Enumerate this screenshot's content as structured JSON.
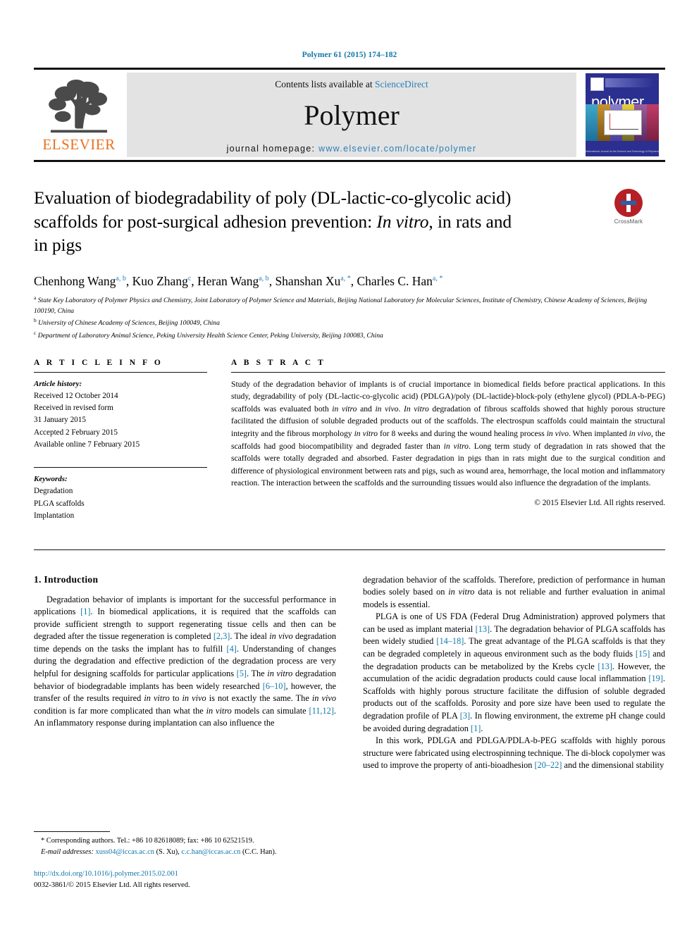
{
  "running_head": "Polymer 61 (2015) 174–182",
  "masthead": {
    "publisher_name": "ELSEVIER",
    "contents_prefix": "Contents lists available at ",
    "contents_link": "ScienceDirect",
    "journal_name": "Polymer",
    "homepage_prefix": "journal homepage: ",
    "homepage_url": "www.elsevier.com/locate/polymer",
    "cover_title": "polymer",
    "cover_footer": "International Journal for the Science and Technology of Polymers"
  },
  "article": {
    "title_line1": "Evaluation of biodegradability of poly (DL-lactic-co-glycolic acid)",
    "title_line2_a": "scaffolds for post-surgical adhesion prevention: ",
    "title_line2_italic": "In vitro",
    "title_line2_b": ", in rats and",
    "title_line3": "in pigs",
    "crossmark_label": "CrossMark",
    "authors": [
      {
        "name": "Chenhong Wang",
        "marks": "a, b"
      },
      {
        "name": "Kuo Zhang",
        "marks": "c"
      },
      {
        "name": "Heran Wang",
        "marks": "a, b"
      },
      {
        "name": "Shanshan Xu",
        "marks": "a, *"
      },
      {
        "name": "Charles C. Han",
        "marks": "a, *"
      }
    ],
    "affiliations": [
      {
        "mark": "a",
        "text": "State Key Laboratory of Polymer Physics and Chemistry, Joint Laboratory of Polymer Science and Materials, Beijing National Laboratory for Molecular Sciences, Institute of Chemistry, Chinese Academy of Sciences, Beijing 100190, China"
      },
      {
        "mark": "b",
        "text": "University of Chinese Academy of Sciences, Beijing 100049, China"
      },
      {
        "mark": "c",
        "text": "Department of Laboratory Animal Science, Peking University Health Science Center, Peking University, Beijing 100083, China"
      }
    ]
  },
  "article_info": {
    "heading": "A R T I C L E  I N F O",
    "history_label": "Article history:",
    "history": [
      "Received 12 October 2014",
      "Received in revised form",
      "31 January 2015",
      "Accepted 2 February 2015",
      "Available online 7 February 2015"
    ],
    "keywords_label": "Keywords:",
    "keywords": [
      "Degradation",
      "PLGA scaffolds",
      "Implantation"
    ]
  },
  "abstract": {
    "heading": "A B S T R A C T",
    "p1": "Study of the degradation behavior of implants is of crucial importance in biomedical fields before practical applications. In this study, degradability of poly (DL-lactic-co-glycolic acid) (PDLGA)/poly (DL-lactide)-block-poly (ethylene glycol) (PDLA-b-PEG) scaffolds was evaluated both ",
    "i1": "in vitro",
    "p2": " and ",
    "i2": "in vivo",
    "p3": ". ",
    "i3": "In vitro",
    "p4": " degradation of fibrous scaffolds showed that highly porous structure facilitated the diffusion of soluble degraded products out of the scaffolds. The electrospun scaffolds could maintain the structural integrity and the fibrous morphology ",
    "i4": "in vitro",
    "p5": " for 8 weeks and during the wound healing process ",
    "i5": "in vivo",
    "p6": ". When implanted ",
    "i6": "in vivo",
    "p7": ", the scaffolds had good biocompatibility and degraded faster than ",
    "i7": "in vitro",
    "p8": ". Long term study of degradation in rats showed that the scaffolds were totally degraded and absorbed. Faster degradation in pigs than in rats might due to the surgical condition and difference of physiological environment between rats and pigs, such as wound area, hemorrhage, the local motion and inflammatory reaction. The interaction between the scaffolds and the surrounding tissues would also influence the degradation of the implants.",
    "copyright": "© 2015 Elsevier Ltd. All rights reserved."
  },
  "introduction": {
    "heading": "1. Introduction",
    "left": {
      "p1_a": "Degradation behavior of implants is important for the successful performance in applications ",
      "r1": "[1]",
      "p1_b": ". In biomedical applications, it is required that the scaffolds can provide sufficient strength to support regenerating tissue cells and then can be degraded after the tissue regeneration is completed ",
      "r2": "[2,3]",
      "p1_c": ". The ideal ",
      "i1": "in vivo",
      "p1_d": " degradation time depends on the tasks the implant has to fulfill ",
      "r3": "[4]",
      "p1_e": ". Understanding of changes during the degradation and effective prediction of the degradation process are very helpful for designing scaffolds for particular applications ",
      "r4": "[5]",
      "p1_f": ". The ",
      "i2": "in vitro",
      "p1_g": " degradation behavior of biodegradable implants has been widely researched ",
      "r5": "[6–10]",
      "p1_h": ", however, the transfer of the results required ",
      "i3": "in vitro",
      "p1_i": " to ",
      "i4": "in vivo",
      "p1_j": " is not exactly the same. The ",
      "i5": "in vivo",
      "p1_k": " condition is far more complicated than what the ",
      "i6": "in vitro",
      "p1_l": " models can simulate ",
      "r6": "[11,12]",
      "p1_m": ". An inflammatory response during implantation can also influence the"
    },
    "right": {
      "p1_a": "degradation behavior of the scaffolds. Therefore, prediction of performance in human bodies solely based on ",
      "i1": "in vitro",
      "p1_b": " data is not reliable and further evaluation in animal models is essential.",
      "p2_a": "PLGA is one of US FDA (Federal Drug Administration) approved polymers that can be used as implant material ",
      "r1": "[13]",
      "p2_b": ". The degradation behavior of PLGA scaffolds has been widely studied ",
      "r2": "[14–18]",
      "p2_c": ". The great advantage of the PLGA scaffolds is that they can be degraded completely in aqueous environment such as the body fluids ",
      "r3": "[15]",
      "p2_d": " and the degradation products can be metabolized by the Krebs cycle ",
      "r4": "[13]",
      "p2_e": ". However, the accumulation of the acidic degradation products could cause local inflammation ",
      "r5": "[19]",
      "p2_f": ". Scaffolds with highly porous structure facilitate the diffusion of soluble degraded products out of the scaffolds. Porosity and pore size have been used to regulate the degradation profile of PLA ",
      "r6": "[3]",
      "p2_g": ". In flowing environment, the extreme pH change could be avoided during degradation ",
      "r7": "[1]",
      "p2_h": ".",
      "p3_a": "In this work, PDLGA and PDLGA/PDLA-b-PEG scaffolds with highly porous structure were fabricated using electrospinning technique. The di-block copolymer was used to improve the property of anti-bioadhesion ",
      "r8": "[20–22]",
      "p3_b": " and the dimensional stability"
    }
  },
  "footnotes": {
    "corresponding_mark": "*",
    "corresponding_text": " Corresponding authors. Tel.: +86 10 82618089; fax: +86 10 62521519.",
    "email_label": "E-mail addresses:",
    "email1": "xuss04@iccas.ac.cn",
    "email1_owner": " (S. Xu), ",
    "email2": "c.c.han@iccas.ac.cn",
    "email2_owner": " (C.C. Han).",
    "doi": "http://dx.doi.org/10.1016/j.polymer.2015.02.001",
    "issn_line": "0032-3861/© 2015 Elsevier Ltd. All rights reserved."
  }
}
